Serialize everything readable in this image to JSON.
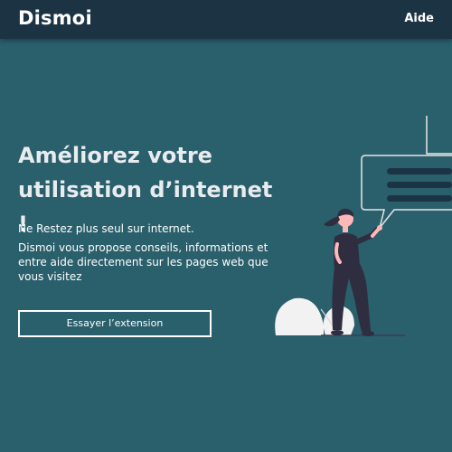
{
  "navbar": {
    "logo": "Dismoi",
    "help_link": "Aide"
  },
  "hero": {
    "headline": "Améliorez votre utilisation d’internet !",
    "lead": "Ne Restez plus seul sur internet.",
    "description": "Dismoi vous propose conseils, informations et entre aide directement sur les pages web que vous visitez",
    "cta_label": "Essayer l’extension"
  },
  "colors": {
    "background": "#2a5f6c",
    "navbar": "#1c3344",
    "text": "#ffffff"
  }
}
